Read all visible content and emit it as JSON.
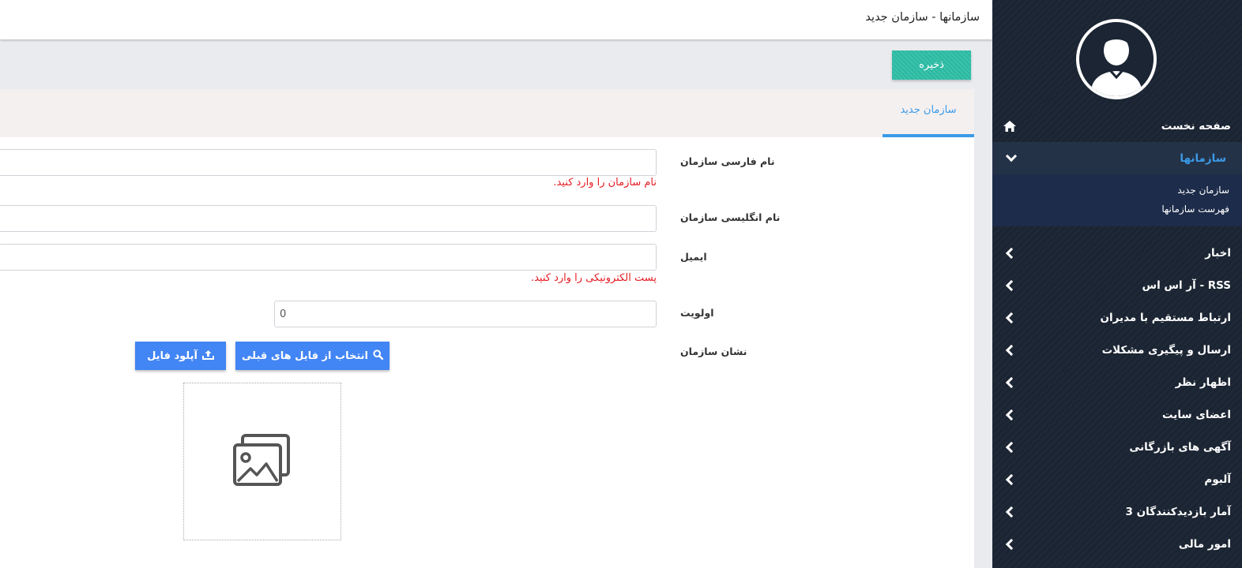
{
  "header": {
    "title": "سازمانها - سازمان جدید"
  },
  "toolbar": {
    "save_label": "ذخیره"
  },
  "tab": {
    "label": "سازمان جدید"
  },
  "form": {
    "name_fa": {
      "label": "نام فارسی سازمان",
      "value": "",
      "error": "نام سازمان را وارد کنید."
    },
    "name_en": {
      "label": "نام انگلیسی سازمان",
      "value": ""
    },
    "email": {
      "label": "ایمیل",
      "value": "",
      "error": "پست الکترونیکی را وارد کنید."
    },
    "priority": {
      "label": "اولویت",
      "value": "0"
    },
    "logo": {
      "label": "نشان سازمان",
      "select_label": "انتخاب از فایل های قبلی",
      "upload_label": "آپلود فایل"
    }
  },
  "sidebar": {
    "home": "صفحه نخست",
    "organizations": {
      "label": "سازمانها",
      "children": [
        "سازمان جدید",
        "فهرست سازمانها"
      ]
    },
    "items": [
      "اخبار",
      "آر اس اس - RSS",
      "ارتباط مستقیم با مدیران",
      "ارسال و پیگیری مشکلات",
      "اظهار نظر",
      "اعضای سایت",
      "آگهی های بازرگانی",
      "آلبوم",
      "آمار بازدیدکنندگان 3",
      "امور مالی"
    ]
  },
  "colors": {
    "accent": "#3a9be8",
    "save": "#2fbfa8",
    "button": "#4285f4",
    "error": "#e51c23",
    "sidebar": "#1b2533"
  }
}
